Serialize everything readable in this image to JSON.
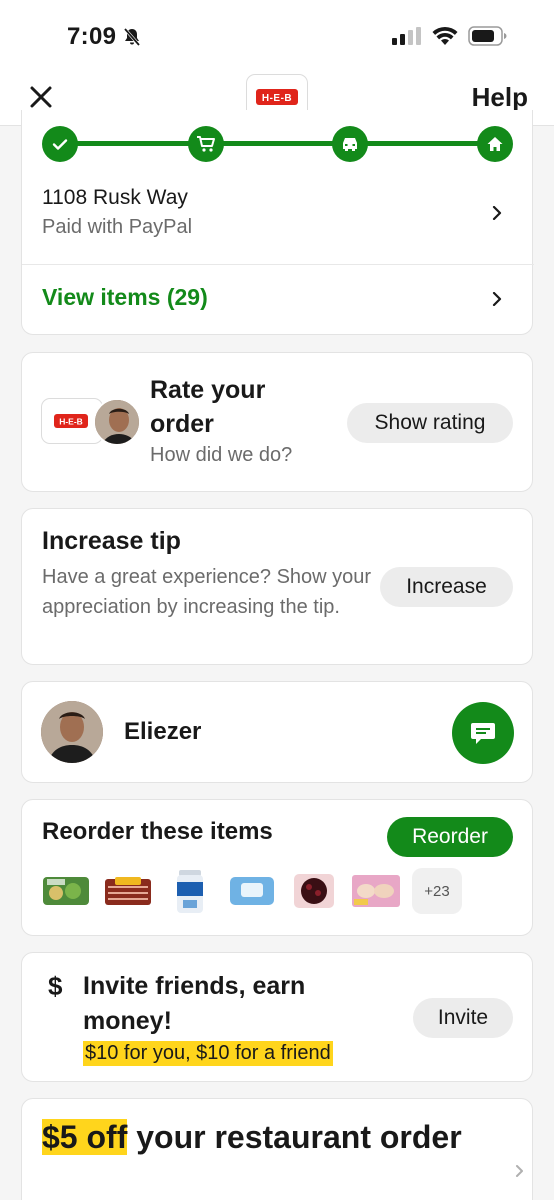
{
  "colors": {
    "brand_green": "#138a1a",
    "highlight_yellow": "#ffd51c",
    "heb_red": "#e0251b"
  },
  "status_bar": {
    "time": "7:09"
  },
  "nav": {
    "help": "Help",
    "logo_text": "H-E-B"
  },
  "progress": {
    "steps": [
      "check-icon",
      "cart-icon",
      "car-icon",
      "home-icon"
    ],
    "address": "1108 Rusk Way",
    "payment": "Paid with PayPal",
    "view_items": "View items (29)"
  },
  "rate": {
    "title": "Rate your order",
    "subtitle": "How did we do?",
    "button": "Show rating",
    "logo_text": "H-E-B"
  },
  "tip": {
    "title": "Increase tip",
    "text": "Have a great experience? Show your appreciation by increasing the tip.",
    "button": "Increase"
  },
  "shopper": {
    "name": "Eliezer"
  },
  "reorder": {
    "title": "Reorder these items",
    "button": "Reorder",
    "items": [
      "salad-kit",
      "bacon",
      "clorox-wipes",
      "wet-wipes",
      "berries",
      "chicken-breast"
    ],
    "more": "+23"
  },
  "invite": {
    "title": "Invite friends, earn money!",
    "highlight": "$10 for you, $10 for a friend",
    "button": "Invite",
    "icon": "$"
  },
  "promo": {
    "highlight": "$5 off",
    "rest": " your restaurant order"
  }
}
